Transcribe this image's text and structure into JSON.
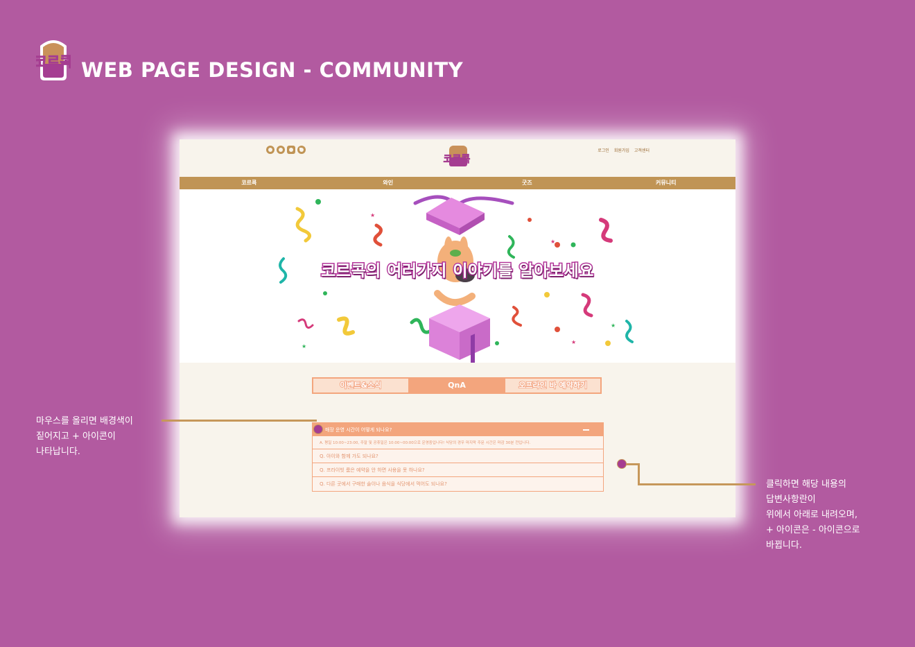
{
  "presentation": {
    "title": "WEB PAGE DESIGN - COMMUNITY",
    "logo_text": "코르콕",
    "brand_colors": {
      "background": "#b25aa0",
      "gold": "#c09455",
      "peach": "#f3a57d",
      "purple": "#a53d91"
    }
  },
  "site": {
    "social_icons": [
      "facebook-icon",
      "instagram-icon",
      "youtube-icon",
      "twitter-icon"
    ],
    "logo_text": "코르콕",
    "top_links": [
      "로그인",
      "회원가입",
      "고객센터"
    ],
    "nav": [
      "코르콕",
      "와인",
      "굿즈",
      "커뮤니티"
    ],
    "hero_title": "코르콕의 여러가지 이야기를 알아보세요",
    "tabs": [
      "이벤트&소식",
      "QnA",
      "오프라인 바 예약하기"
    ],
    "active_tab": "QnA",
    "faq": {
      "open_question": "매장 운영 시간이 어떻게 되나요?",
      "open_answer": "A. 평일 10:00~23:00, 주말 및 공휴일은 10:00~00:00으로 운영중입니다! 식당의 경우 마지막 주문 시간은 마감 30분 전입니다.",
      "questions": [
        "Q. 아이와 함께 가도 되나요?",
        "Q. 프라이빗 룸은 예약을 안 하면 사용을 못 하나요?",
        "Q. 다른 곳에서 구매한 술이나 음식을 식당에서 먹어도 되나요?"
      ]
    }
  },
  "annotations": {
    "left": [
      "마우스를 올리면 배경색이",
      "짙어지고 + 아이콘이",
      "나타납니다."
    ],
    "right": [
      "클릭하면 해당 내용의",
      "답변사항란이",
      "위에서 아래로 내려오며,",
      "+ 아이콘은 - 아이콘으로",
      "바뀝니다."
    ]
  }
}
